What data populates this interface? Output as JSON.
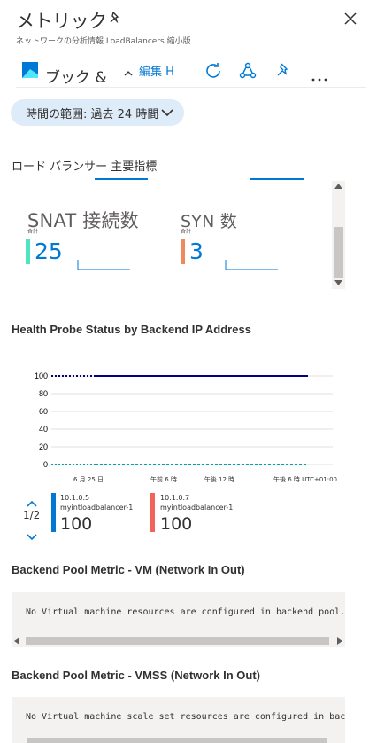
{
  "header": {
    "title": "メトリック",
    "subtitle": "ネットワークの分析情報 LoadBalancers 縮小版"
  },
  "toolbar": {
    "workbook_label": "ブック &",
    "edit_label": "編集 H"
  },
  "time_range": {
    "label": "時間の範囲: 過去 24 時間"
  },
  "lb_section": {
    "title": "ロード バランサー 主要指標",
    "tiles": [
      {
        "name": "SNAT 接続数",
        "sub": "合計",
        "value": "25",
        "bar_color": "#4ee6c2"
      },
      {
        "name": "SYN 数",
        "sub": "合計",
        "value": "3",
        "bar_color": "#f08a5d"
      }
    ]
  },
  "health_chart": {
    "title": "Health Probe Status by Backend IP Address",
    "y_ticks": [
      "100",
      "80",
      "60",
      "40",
      "20",
      "0"
    ],
    "x_ticks": [
      "6 月 25 日",
      "午前 6 時",
      "午後 12 時",
      "午後 6 時 UTC+01:00"
    ],
    "pager": "1/2",
    "legend": [
      {
        "ip": "10.1.0.5",
        "name": "myintloadbalancer-1",
        "value": "100",
        "color": "#0078d4"
      },
      {
        "ip": "10.1.0.7",
        "name": "myintloadbalancer-1",
        "value": "100",
        "color": "#f2645a"
      }
    ]
  },
  "chart_data": {
    "type": "line",
    "title": "Health Probe Status by Backend IP Address",
    "x": [
      "6 月 25 日",
      "午前 6 時",
      "午後 12 時",
      "午後 6 時"
    ],
    "ylim": [
      0,
      100
    ],
    "grid": true,
    "series": [
      {
        "name": "10.1.0.5",
        "values": [
          100,
          100,
          100,
          100
        ],
        "color": "#000080"
      },
      {
        "name": "10.1.0.7",
        "values": [
          0,
          0,
          0,
          0
        ],
        "color": "#00a2ad"
      }
    ]
  },
  "vm_section": {
    "title": "Backend Pool Metric - VM (Network In Out)",
    "message": "No Virtual machine resources are configured in backend pool."
  },
  "vmss_section": {
    "title": "Backend Pool Metric - VMSS (Network In Out)",
    "message": "No Virtual machine scale set resources are configured in backend pool."
  }
}
